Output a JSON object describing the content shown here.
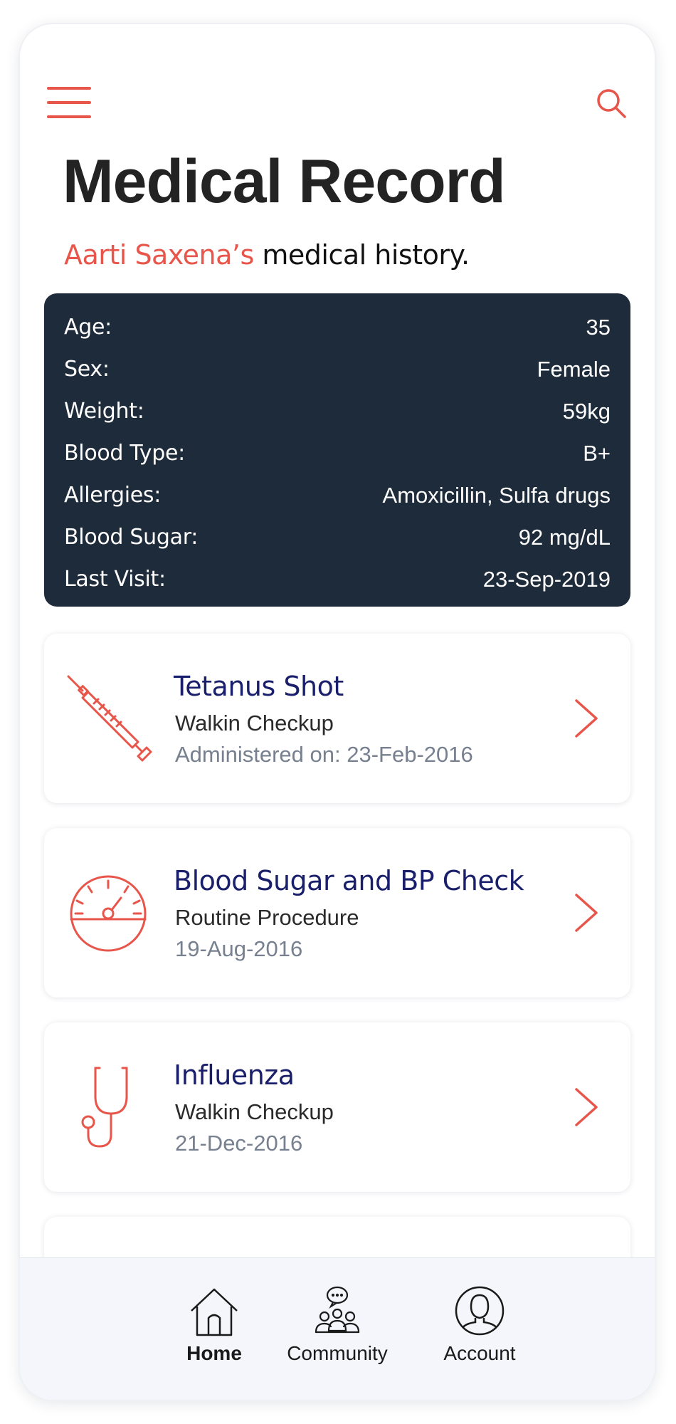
{
  "header": {
    "title": "Medical Record",
    "subtitle_name": "Aarti Saxena’s",
    "subtitle_rest": " medical history."
  },
  "icons": {
    "menu": "hamburger-menu-icon",
    "search": "search-icon"
  },
  "colors": {
    "accent": "#e8564b",
    "dark_card": "#1e2b3a",
    "heading": "#1a1f6b",
    "muted": "#77808f"
  },
  "patient_info": [
    {
      "label": "Age:",
      "value": "35"
    },
    {
      "label": "Sex:",
      "value": "Female"
    },
    {
      "label": "Weight:",
      "value": "59kg"
    },
    {
      "label": "Blood Type:",
      "value": "B+"
    },
    {
      "label": "Allergies:",
      "value": "Amoxicillin, Sulfa drugs"
    },
    {
      "label": "Blood Sugar:",
      "value": "92 mg/dL"
    },
    {
      "label": "Last Visit:",
      "value": "23-Sep-2019"
    }
  ],
  "records": [
    {
      "icon": "syringe-icon",
      "title": "Tetanus Shot",
      "type": "Walkin Checkup",
      "date": "Administered on: 23-Feb-2016"
    },
    {
      "icon": "gauge-icon",
      "title": "Blood Sugar and BP Check",
      "type": "Routine Procedure",
      "date": "19-Aug-2016"
    },
    {
      "icon": "stethoscope-icon",
      "title": "Influenza",
      "type": "Walkin Checkup",
      "date": "21-Dec-2016"
    }
  ],
  "nav": [
    {
      "label": "Home",
      "icon": "home-icon",
      "active": true
    },
    {
      "label": "Community",
      "icon": "community-icon",
      "active": false
    },
    {
      "label": "Account",
      "icon": "account-icon",
      "active": false
    }
  ]
}
